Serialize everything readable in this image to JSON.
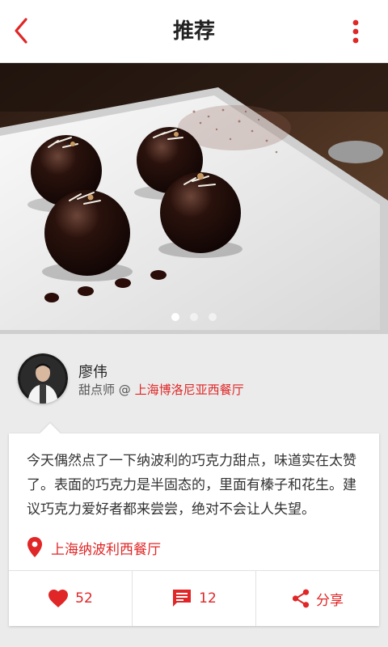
{
  "header": {
    "title": "推荐",
    "back_icon": "chevron-left-icon",
    "menu_icon": "more-vert-icon"
  },
  "colors": {
    "accent": "#e02626",
    "background": "#ebebeb",
    "card": "#ffffff"
  },
  "carousel": {
    "page_count": 3,
    "active_index": 0
  },
  "author": {
    "name": "廖伟",
    "role": "甜点师 @",
    "restaurant": "上海博洛尼亚西餐厅"
  },
  "post": {
    "text": "今天偶然点了一下纳波利的巧克力甜点，味道实在太赞了。表面的巧克力是半固态的，里面有榛子和花生。建议巧克力爱好者都来尝尝，绝对不会让人失望。",
    "location": "上海纳波利西餐厅"
  },
  "actions": {
    "likes": "52",
    "comments": "12",
    "share_label": "分享"
  }
}
